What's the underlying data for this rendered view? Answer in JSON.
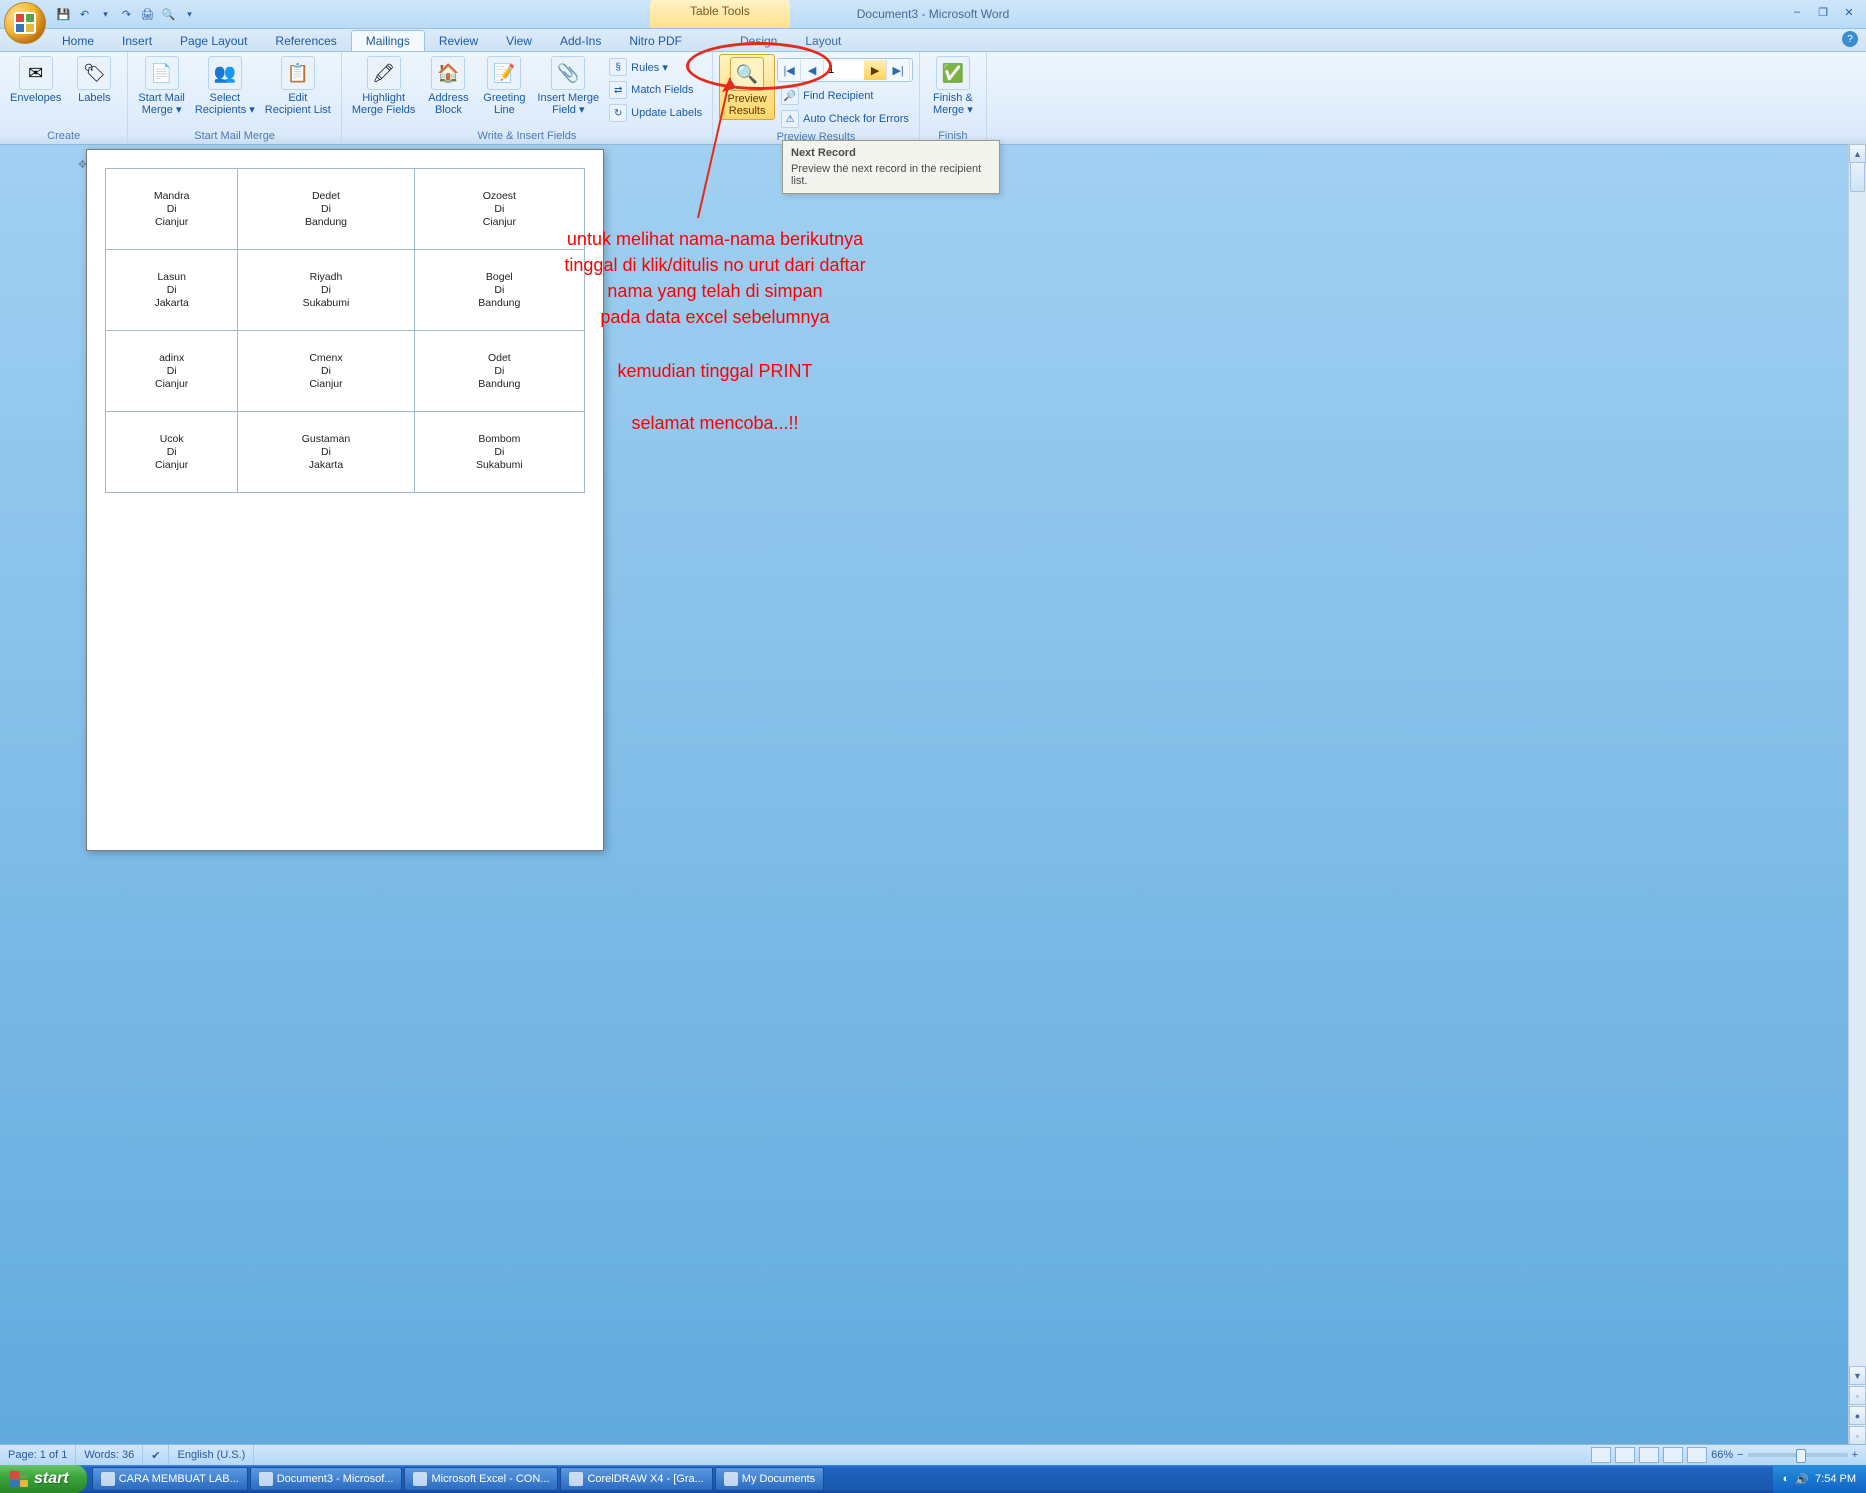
{
  "title": "Document3 - Microsoft Word",
  "context_tab": "Table Tools",
  "qat": {
    "save": "💾",
    "undo": "↶",
    "redo": "↷",
    "print": "🖨",
    "preview": "🔍",
    "dd": "▾"
  },
  "winbtns": {
    "min": "–",
    "restore": "❐",
    "close": "✕"
  },
  "tabs": [
    "Home",
    "Insert",
    "Page Layout",
    "References",
    "Mailings",
    "Review",
    "View",
    "Add-Ins",
    "Nitro PDF"
  ],
  "context_tabs": [
    "Design",
    "Layout"
  ],
  "active_tab": "Mailings",
  "ribbon": {
    "create": {
      "label": "Create",
      "envelopes": "Envelopes",
      "labels": "Labels"
    },
    "startmm": {
      "label": "Start Mail Merge",
      "start": "Start Mail\nMerge ▾",
      "select": "Select\nRecipients ▾",
      "edit": "Edit\nRecipient List"
    },
    "write": {
      "label": "Write & Insert Fields",
      "highlight": "Highlight\nMerge Fields",
      "address": "Address\nBlock",
      "greeting": "Greeting\nLine",
      "insert": "Insert Merge\nField ▾",
      "rules": "Rules ▾",
      "match": "Match Fields",
      "update": "Update Labels"
    },
    "preview": {
      "label": "Preview Results",
      "preview_btn": "Preview\nResults",
      "record_no": "1",
      "find": "Find Recipient",
      "check": "Auto Check for Errors"
    },
    "nav": {
      "first": "|◀",
      "prev": "◀",
      "next": "▶",
      "last": "▶|"
    },
    "finish": {
      "label": "Finish",
      "btn": "Finish &\nMerge ▾"
    }
  },
  "tooltip": {
    "title": "Next Record",
    "body": "Preview the next record in the recipient list."
  },
  "labels": [
    [
      {
        "n": "Mandra",
        "d": "Di",
        "c": "Cianjur"
      },
      {
        "n": "Dedet",
        "d": "Di",
        "c": "Bandung"
      },
      {
        "n": "Ozoest",
        "d": "Di",
        "c": "Cianjur"
      }
    ],
    [
      {
        "n": "Lasun",
        "d": "Di",
        "c": "Jakarta"
      },
      {
        "n": "Riyadh",
        "d": "Di",
        "c": "Sukabumi"
      },
      {
        "n": "Bogel",
        "d": "Di",
        "c": "Bandung"
      }
    ],
    [
      {
        "n": "adinx",
        "d": "Di",
        "c": "Cianjur"
      },
      {
        "n": "Cmenx",
        "d": "Di",
        "c": "Cianjur"
      },
      {
        "n": "Odet",
        "d": "Di",
        "c": "Bandung"
      }
    ],
    [
      {
        "n": "Ucok",
        "d": "Di",
        "c": "Cianjur"
      },
      {
        "n": "Gustaman",
        "d": "Di",
        "c": "Jakarta"
      },
      {
        "n": "Bombom",
        "d": "Di",
        "c": "Sukabumi"
      }
    ]
  ],
  "annotation": {
    "p1": "untuk melihat nama-nama berikutnya\ntinggal di klik/ditulis no urut dari daftar\nnama yang telah di simpan\npada data excel sebelumnya",
    "p2": "kemudian tinggal PRINT",
    "p3": "selamat mencoba...!!"
  },
  "status": {
    "page": "Page: 1 of 1",
    "words": "Words: 36",
    "lang": "English (U.S.)",
    "zoom": "66%"
  },
  "taskbar": {
    "start": "start",
    "items": [
      "CARA MEMBUAT LAB...",
      "Document3 - Microsof...",
      "Microsoft Excel - CON...",
      "CorelDRAW X4 - [Gra...",
      "My Documents"
    ],
    "time": "7:54 PM"
  }
}
